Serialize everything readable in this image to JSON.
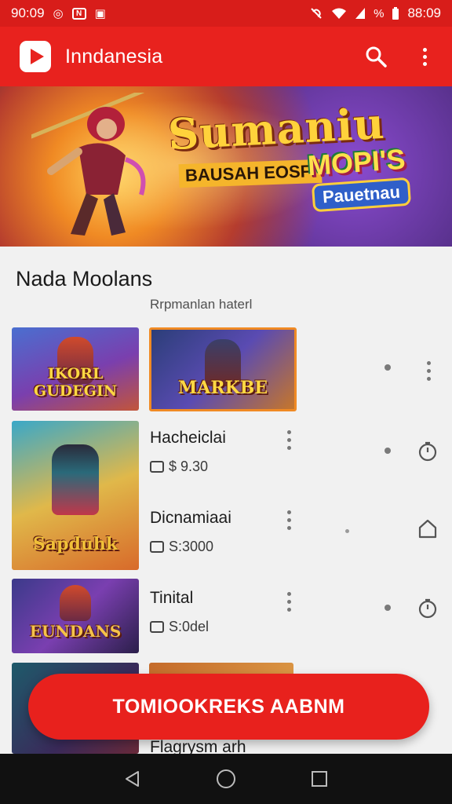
{
  "status_bar": {
    "time_left": "90:09",
    "time_right": "88:09",
    "battery_text": "%"
  },
  "app_bar": {
    "title": "Inndanesia",
    "logo_icon": "play-logo-icon",
    "search_icon": "search-icon",
    "more_icon": "more-vert-icon"
  },
  "banner": {
    "title": "Sumaniu",
    "subtitle": "BAUSAH EOSFI",
    "badge_top": "MOPI'S",
    "badge_bottom": "Pauetnau"
  },
  "section": {
    "title": "Nada Moolans",
    "subtitle": "Rrpmanlan haterl"
  },
  "thumbs": {
    "first": "IKORL GUDEGIN",
    "featured": "MARKBE",
    "second": "Sapduhk",
    "third": "EUNDANS"
  },
  "items": [
    {
      "title": "Hacheiclai",
      "meta": "$ 9.30"
    },
    {
      "title": "Dicnamiaai",
      "meta": "S:3000"
    },
    {
      "title": "Tinital",
      "meta": "S:0del"
    },
    {
      "title": "Flagrysm arh",
      "meta": ""
    }
  ],
  "fab": {
    "label": "TOMIOOKREKS AABNM"
  },
  "colors": {
    "primary": "#e8221e",
    "status_bar": "#d81d1a",
    "background": "#f1f1f1",
    "nav_bar": "#111111"
  }
}
